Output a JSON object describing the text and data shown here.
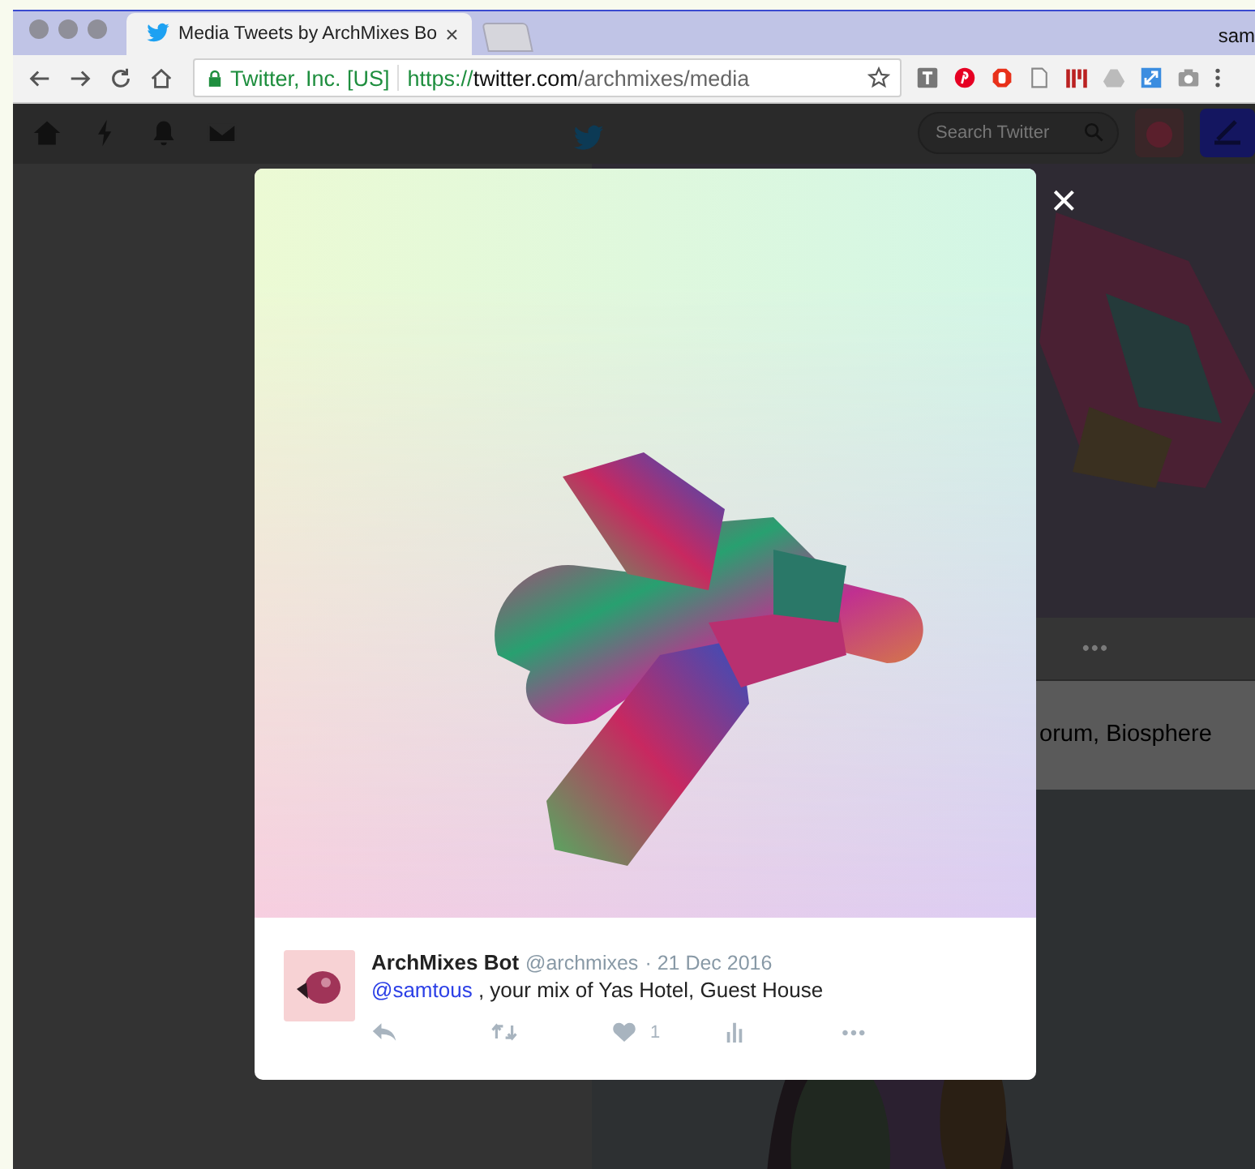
{
  "browser": {
    "tab": {
      "title": "Media Tweets by ArchMixes Bo",
      "close": "×"
    },
    "profile": "sam",
    "address": {
      "org": "Twitter, Inc. [US]",
      "scheme": "https://",
      "host": "twitter.com",
      "path": "/archmixes/media"
    }
  },
  "twitter_nav": {
    "search": {
      "placeholder": "Search Twitter"
    }
  },
  "background": {
    "more": "•••",
    "text": "orum, Biosphere"
  },
  "modal": {
    "close": "×",
    "tweet": {
      "name": "ArchMixes Bot",
      "handle": "@archmixes",
      "date": "· 21 Dec 2016",
      "mention": "@samtous",
      "text": " , your mix of Yas Hotel, Guest House",
      "likes": "1",
      "more": "•••"
    }
  }
}
